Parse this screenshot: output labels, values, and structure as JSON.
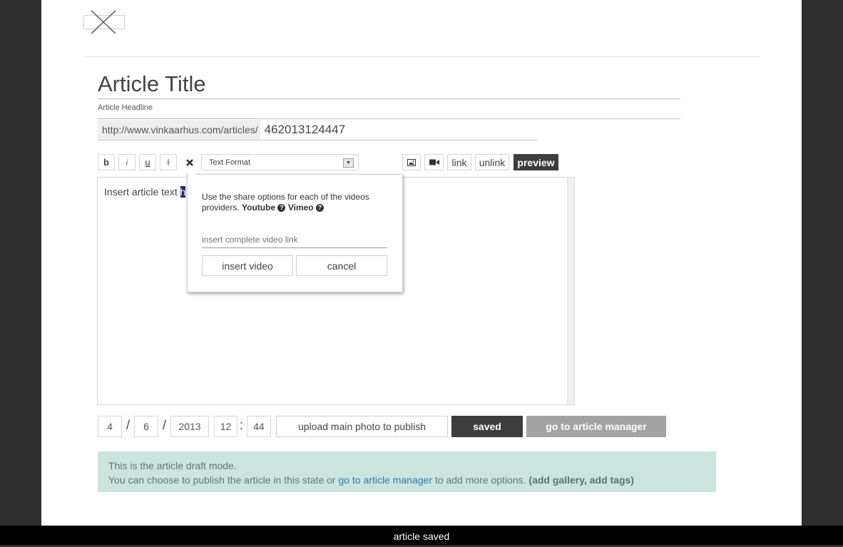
{
  "article": {
    "title": "Article Title",
    "headline_placeholder": "Article Headline",
    "url_prefix": "http://www.vinkaarhus.com/articles/",
    "url_id": "462013124447"
  },
  "toolbar": {
    "bold": "b",
    "italic": "i",
    "underline": "u",
    "strike": "I",
    "clear_icon": "close-icon",
    "format_select": "Text Format",
    "image_icon": "image-icon",
    "video_icon": "video-icon",
    "link": "link",
    "unlink": "unlink",
    "preview": "preview"
  },
  "editor": {
    "text": "Insert article text ",
    "selected": "h"
  },
  "video_popup": {
    "message_prefix": "Use the share options for each of the videos providers.",
    "provider_1": "Youtube",
    "provider_2": "Vimeo",
    "help_icon": "?",
    "input_placeholder": "insert complete video link",
    "insert_label": "insert video",
    "cancel_label": "cancel"
  },
  "publish": {
    "month": "4",
    "day": "6",
    "year": "2013",
    "hour": "12",
    "minute": "44",
    "date_sep": "/",
    "time_sep": ":",
    "upload_label": "upload main photo to publish",
    "saved_label": "saved",
    "manager_label": "go to article manager"
  },
  "info": {
    "line1": "This is the article draft mode.",
    "line2_prefix": "You can choose to publish the article in this state or ",
    "line2_link": "go to article manager",
    "line2_suffix": " to add more options. ",
    "line2_bold": "(add gallery, add tags)"
  },
  "status": {
    "message": "article saved"
  },
  "colors": {
    "dark_button": "#3d3d3d",
    "grey_button": "#a3a3a3",
    "info_bg": "#cce4de",
    "link": "#2a7ab8"
  }
}
